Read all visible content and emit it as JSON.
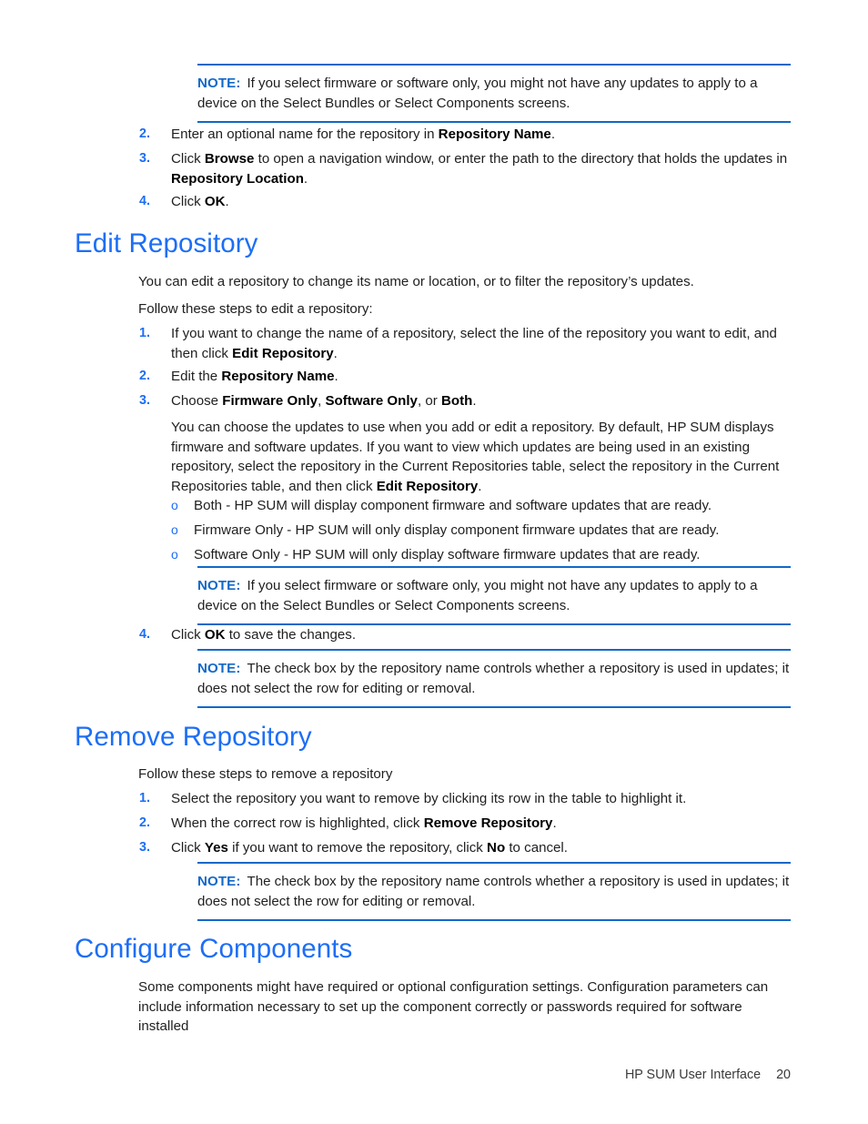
{
  "document": {
    "footer_title": "HP SUM User Interface",
    "page_number": "20",
    "accent_blue": "#1d6ef5",
    "note_blue": "#1268c8",
    "note_label": "NOTE:"
  },
  "note_top": {
    "label": "NOTE:",
    "text": "If you select firmware or software only, you might not have any updates to apply to a device on the Select Bundles or Select Components screens."
  },
  "intro_steps": [
    {
      "marker": "2.",
      "parts": [
        {
          "t": "Enter an optional name for the repository in ",
          "b": false
        },
        {
          "t": "Repository Name",
          "b": true
        },
        {
          "t": ".",
          "b": false
        }
      ]
    },
    {
      "marker": "3.",
      "parts": [
        {
          "t": "Click ",
          "b": false
        },
        {
          "t": "Browse",
          "b": true
        },
        {
          "t": " to open a navigation window, or enter the path to the directory that holds the updates in ",
          "b": false
        },
        {
          "t": "Repository Location",
          "b": true
        },
        {
          "t": ".",
          "b": false
        }
      ]
    },
    {
      "marker": "4.",
      "parts": [
        {
          "t": "Click ",
          "b": false
        },
        {
          "t": "OK",
          "b": true
        },
        {
          "t": ".",
          "b": false
        }
      ]
    }
  ],
  "edit_repository": {
    "heading": "Edit Repository",
    "intro_1": "You can edit a repository to change its name or location, or to filter the repository’s updates.",
    "intro_2": "Follow these steps to edit a repository:",
    "steps": [
      {
        "marker": "1.",
        "parts": [
          {
            "t": "If you want to change the name of a repository, select the line of the repository you want to edit, and then click ",
            "b": false
          },
          {
            "t": "Edit Repository",
            "b": true
          },
          {
            "t": ".",
            "b": false
          }
        ]
      },
      {
        "marker": "2.",
        "parts": [
          {
            "t": "Edit the ",
            "b": false
          },
          {
            "t": "Repository Name",
            "b": true
          },
          {
            "t": ".",
            "b": false
          }
        ]
      },
      {
        "marker": "3.",
        "parts": [
          {
            "t": "Choose ",
            "b": false
          },
          {
            "t": "Firmware Only",
            "b": true
          },
          {
            "t": ", ",
            "b": false
          },
          {
            "t": "Software Only",
            "b": true
          },
          {
            "t": ", or ",
            "b": false
          },
          {
            "t": "Both",
            "b": true
          },
          {
            "t": ".",
            "b": false
          }
        ]
      }
    ],
    "explanation_parts": [
      {
        "t": "You can choose the updates to use when you add or edit a repository. By default, HP SUM displays firmware and software updates. If you want to view which updates are being used in an existing repository, select the repository in the Current Repositories table, select the repository in the Current Repositories table, and then click ",
        "b": false
      },
      {
        "t": "Edit Repository",
        "b": true
      },
      {
        "t": ".",
        "b": false
      }
    ],
    "sub_bullets": [
      {
        "marker": "o",
        "text": "Both - HP SUM will display component firmware and software updates that are ready."
      },
      {
        "marker": "o",
        "text": "Firmware Only - HP SUM will only display component firmware updates that are ready."
      },
      {
        "marker": "o",
        "text": "Software Only - HP SUM will only display software firmware updates that are ready."
      }
    ],
    "note_firmware": {
      "label": "NOTE:",
      "text": "If you select firmware or software only, you might not have any updates to apply to a device on the Select Bundles or Select Components screens."
    },
    "step_4": {
      "marker": "4.",
      "parts": [
        {
          "t": "Click ",
          "b": false
        },
        {
          "t": "OK",
          "b": true
        },
        {
          "t": " to save the changes.",
          "b": false
        }
      ]
    },
    "note_checkbox": {
      "label": "NOTE:",
      "text": "The check box by the repository name controls whether a repository is used in updates; it does not select the row for editing or removal."
    }
  },
  "remove_repository": {
    "heading": "Remove Repository",
    "intro": "Follow these steps to remove a repository",
    "steps": [
      {
        "marker": "1.",
        "parts": [
          {
            "t": "Select the repository you want to remove by clicking its row in the table to highlight it.",
            "b": false
          }
        ]
      },
      {
        "marker": "2.",
        "parts": [
          {
            "t": "When the correct row is highlighted, click ",
            "b": false
          },
          {
            "t": "Remove Repository",
            "b": true
          },
          {
            "t": ".",
            "b": false
          }
        ]
      },
      {
        "marker": "3.",
        "parts": [
          {
            "t": "Click ",
            "b": false
          },
          {
            "t": "Yes",
            "b": true
          },
          {
            "t": " if you want to remove the repository, click ",
            "b": false
          },
          {
            "t": "No",
            "b": true
          },
          {
            "t": " to cancel.",
            "b": false
          }
        ]
      }
    ],
    "note_checkbox": {
      "label": "NOTE:",
      "text": "The check box by the repository name controls whether a repository is used in updates; it does not select the row for editing or removal."
    }
  },
  "configure_components": {
    "heading": "Configure Components",
    "body": "Some components might have required or optional configuration settings. Configuration parameters can include information necessary to set up the component correctly or passwords required for software installed"
  }
}
